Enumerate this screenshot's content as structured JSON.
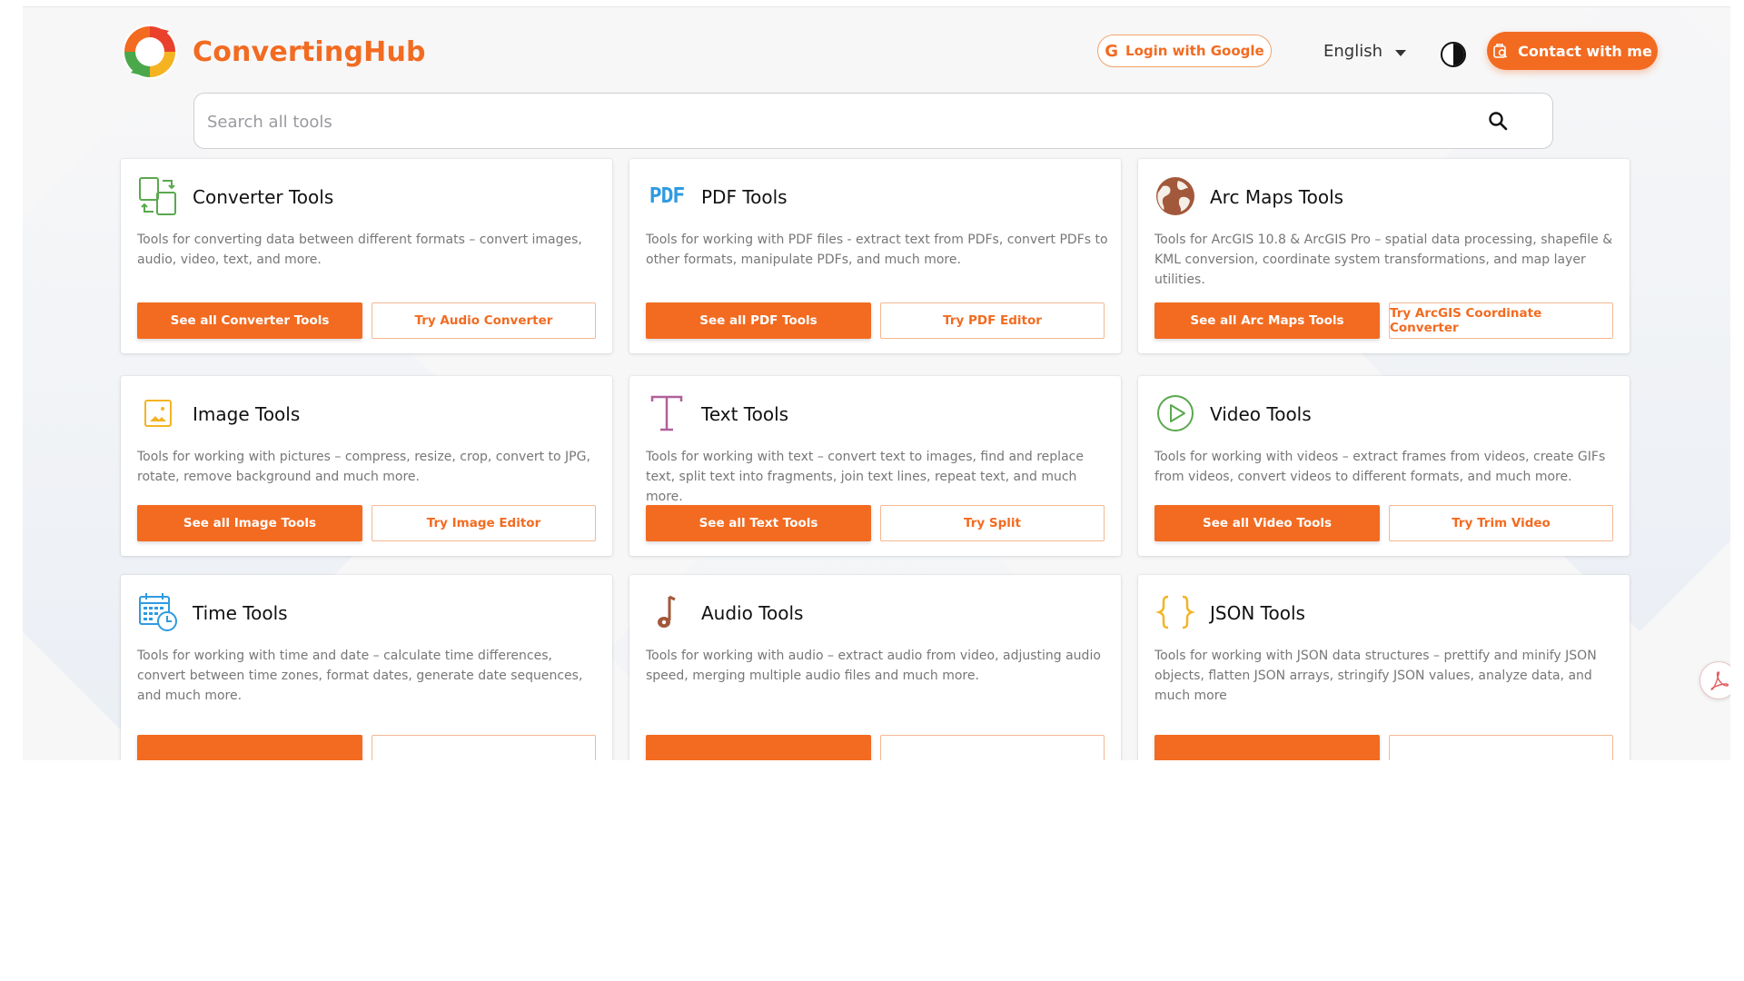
{
  "header": {
    "brand": "ConvertingHub",
    "login_label": "Login with Google",
    "language": "English",
    "contact_label": "Contact with me"
  },
  "search": {
    "placeholder": "Search all tools"
  },
  "cards": [
    {
      "title": "Converter Tools",
      "desc": "Tools for converting data between different formats – convert images, audio, video, text, and more.",
      "primary": "See all Converter Tools",
      "secondary": "Try Audio Converter"
    },
    {
      "title": "PDF Tools",
      "desc": "Tools for working with PDF files - extract text from PDFs, convert PDFs to other formats, manipulate PDFs, and much more.",
      "primary": "See all PDF Tools",
      "secondary": "Try PDF Editor",
      "icon_text": "PDF"
    },
    {
      "title": "Arc Maps Tools",
      "desc": "Tools for ArcGIS 10.8 & ArcGIS Pro – spatial data processing, shapefile & KML conversion, coordinate system transformations, and map layer utilities.",
      "primary": "See all Arc Maps Tools",
      "secondary": "Try ArcGIS Coordinate Converter"
    },
    {
      "title": "Image Tools",
      "desc": "Tools for working with pictures – compress, resize, crop, convert to JPG, rotate, remove background and much more.",
      "primary": "See all Image Tools",
      "secondary": "Try Image Editor"
    },
    {
      "title": "Text Tools",
      "desc": "Tools for working with text – convert text to images, find and replace text, split text into fragments, join text lines, repeat text, and much more.",
      "primary": "See all Text Tools",
      "secondary": "Try Split"
    },
    {
      "title": "Video Tools",
      "desc": "Tools for working with videos – extract frames from videos, create GIFs from videos, convert videos to different formats, and much more.",
      "primary": "See all Video Tools",
      "secondary": "Try Trim Video"
    },
    {
      "title": "Time Tools",
      "desc": "Tools for working with time and date – calculate time differences, convert between time zones, format dates, generate date sequences, and much more."
    },
    {
      "title": "Audio Tools",
      "desc": "Tools for working with audio – extract audio from video, adjusting audio speed, merging multiple audio files and much more."
    },
    {
      "title": "JSON Tools",
      "desc": "Tools for working with JSON data structures – prettify and minify JSON objects, flatten JSON arrays, stringify JSON values, analyze data, and much more"
    }
  ],
  "colors": {
    "accent": "#f26b21",
    "page_bg": "#f7f7f8"
  },
  "icons": [
    "logo-icon",
    "google-g-icon",
    "caret-down-icon",
    "theme-toggle-icon",
    "contact-icon",
    "search-icon",
    "converter-icon",
    "pdf-icon",
    "globe-icon",
    "image-icon",
    "text-icon",
    "play-icon",
    "calendar-clock-icon",
    "music-note-icon",
    "json-braces-icon",
    "pdf-float-icon"
  ]
}
